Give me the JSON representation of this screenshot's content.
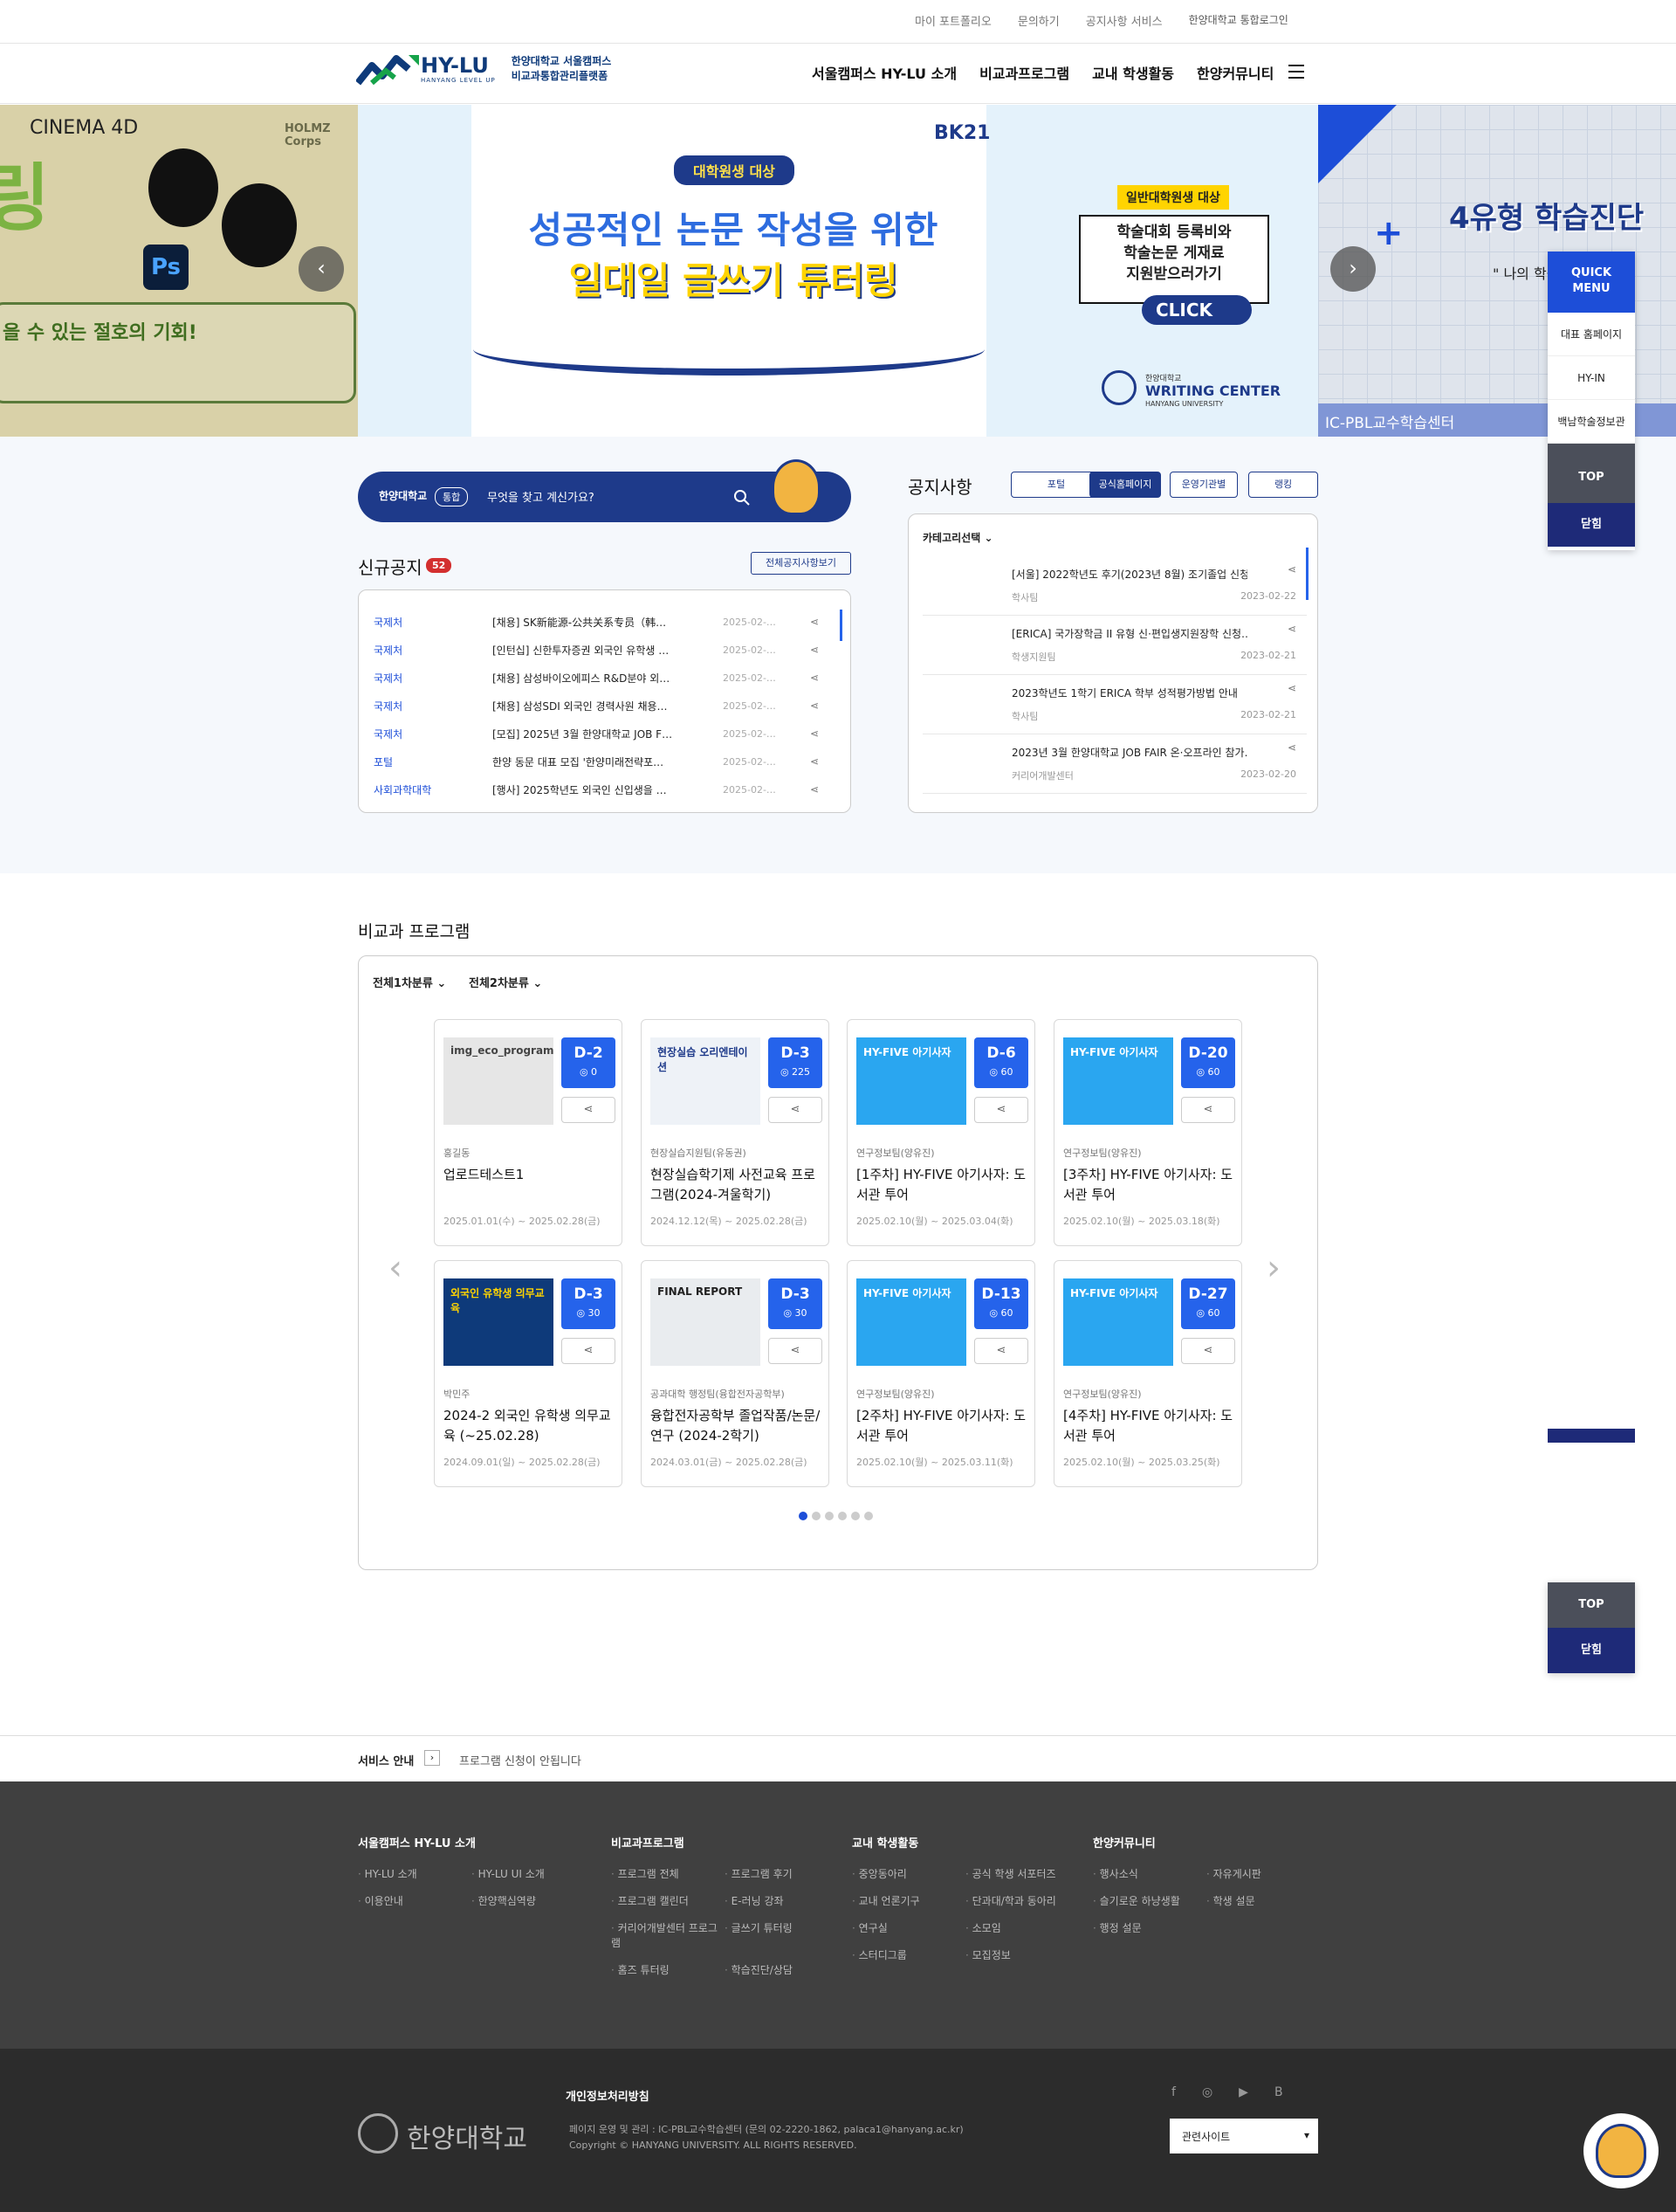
{
  "topbar": {
    "links": [
      "마이 포트폴리오",
      "문의하기",
      "공지사항 서비스",
      "한양대학교 통합로그인"
    ]
  },
  "header": {
    "logo_title": "HY-LU",
    "logo_sub": "HANYANG LEVEL UP",
    "logo_desc1": "한양대학교 서울캠퍼스",
    "logo_desc2": "비교과통합관리플랫폼",
    "nav": [
      "서울캠퍼스 HY-LU 소개",
      "비교과프로그램",
      "교내 학생활동",
      "한양커뮤니티"
    ]
  },
  "slider": {
    "left": {
      "brand": "CINEMA 4D",
      "corner": "HOLMZ Corps",
      "ps": "Ps",
      "big": "링",
      "line": "을 수 있는 절호의 기회!"
    },
    "mid": {
      "badge": "대학원생 대상",
      "title1": "성공적인 논문 작성을 위한",
      "title2": "일대일 글쓰기 튜터링",
      "bk": "BK21",
      "side_badge": "일반대학원생 대상",
      "side1": "학술대회 등록비와",
      "side2": "학술논문 게재료",
      "side3": "지원받으러가기",
      "click": "CLICK",
      "wc_top": "한양대학교",
      "wc": "WRITING CENTER",
      "wc_sub": "HANYANG UNIVERSITY"
    },
    "right": {
      "title": "4유형 학습진단",
      "quote": "\" 나의 학습자 문",
      "caption": "IC-PBL교수학습센터"
    },
    "dot_count": 7
  },
  "search": {
    "univ": "한양대학교",
    "tag": "통합",
    "placeholder": "무엇을 찾고 계신가요?"
  },
  "new_notice": {
    "title": "신규공지",
    "count": "52",
    "all_button": "전체공지사항보기",
    "rows": [
      {
        "cat": "국제처",
        "title": "[채용] SK新能源-公共关系专员（韩…",
        "date": "2025-02-…"
      },
      {
        "cat": "국제처",
        "title": "[인턴십] 신한투자증권 외국인 유학생 …",
        "date": "2025-02-…"
      },
      {
        "cat": "국제처",
        "title": "[채용] 삼성바이오에피스 R&D분야 외…",
        "date": "2025-02-…"
      },
      {
        "cat": "국제처",
        "title": "[채용] 삼성SDI 외국인 경력사원 채용…",
        "date": "2025-02-…"
      },
      {
        "cat": "국제처",
        "title": "[모집] 2025년 3월 한양대학교 JOB F…",
        "date": "2025-02-…"
      },
      {
        "cat": "포털",
        "title": "한양 동문 대표 모집 '한양미래전략포…",
        "date": "2025-02-…"
      },
      {
        "cat": "사회과학대학",
        "title": "[행사] 2025학년도 외국인 신입생을 …",
        "date": "2025-02-…"
      }
    ]
  },
  "announce": {
    "title": "공지사항",
    "tabs": [
      "포털",
      "공식홈페이지",
      "운영기관별",
      "랭킹"
    ],
    "category": "카테고리선택",
    "rows": [
      {
        "title": "[서울] 2022학년도 후기(2023년 8월) 조기졸업 신청 …",
        "dept": "학사팀",
        "date": "2023-02-22"
      },
      {
        "title": "[ERICA] 국가장학금 II 유형 신·편입생지원장학 신청…",
        "dept": "학생지원팀",
        "date": "2023-02-21"
      },
      {
        "title": "2023학년도 1학기 ERICA 학부 성적평가방법 안내",
        "dept": "학사팀",
        "date": "2023-02-21"
      },
      {
        "title": "2023년 3월 한양대학교 JOB FAIR 온·오프라인 참가…",
        "dept": "커리어개발센터",
        "date": "2023-02-20"
      }
    ]
  },
  "quick": {
    "title1": "QUICK",
    "title2": "MENU",
    "items": [
      "대표 홈페이지",
      "HY-IN",
      "백남학술정보관"
    ],
    "top": "TOP",
    "close": "닫힘"
  },
  "programs": {
    "title": "비교과 프로그램",
    "filter1": "전체1차분류",
    "filter2": "전체2차분류",
    "dot_count": 6,
    "cards": [
      {
        "d": "D-2",
        "views": "0",
        "org": "홍길동",
        "name": "업로드테스트1",
        "period": "2025.01.01(수) ~ 2025.02.28(금)",
        "thumb": "img_eco_program"
      },
      {
        "d": "D-3",
        "views": "225",
        "org": "현장실습지원팀(유동권)",
        "name": "현장실습학기제 사전교육 프로그램(2024-겨울학기)",
        "period": "2024.12.12(목) ~ 2025.02.28(금)",
        "thumb": "현장실습 오리엔테이션"
      },
      {
        "d": "D-6",
        "views": "60",
        "org": "연구정보팀(양유진)",
        "name": "[1주차] HY-FIVE 아기사자: 도서관 투어",
        "period": "2025.02.10(월) ~ 2025.03.04(화)",
        "thumb": "HY-FIVE 아기사자"
      },
      {
        "d": "D-20",
        "views": "60",
        "org": "연구정보팀(양유진)",
        "name": "[3주차] HY-FIVE 아기사자: 도서관 투어",
        "period": "2025.02.10(월) ~ 2025.03.18(화)",
        "thumb": "HY-FIVE 아기사자"
      },
      {
        "d": "D-3",
        "views": "30",
        "org": "박민주",
        "name": "2024-2 외국인 유학생 의무교육 (~25.02.28)",
        "period": "2024.09.01(일) ~ 2025.02.28(금)",
        "thumb": "외국인 유학생 의무교육"
      },
      {
        "d": "D-3",
        "views": "30",
        "org": "공과대학 행정팀(융합전자공학부)",
        "name": "융합전자공학부 졸업작품/논문/연구 (2024-2학기)",
        "period": "2024.03.01(금) ~ 2025.02.28(금)",
        "thumb": "FINAL REPORT"
      },
      {
        "d": "D-13",
        "views": "60",
        "org": "연구정보팀(양유진)",
        "name": "[2주차] HY-FIVE 아기사자: 도서관 투어",
        "period": "2025.02.10(월) ~ 2025.03.11(화)",
        "thumb": "HY-FIVE 아기사자"
      },
      {
        "d": "D-27",
        "views": "60",
        "org": "연구정보팀(양유진)",
        "name": "[4주차] HY-FIVE 아기사자: 도서관 투어",
        "period": "2025.02.10(월) ~ 2025.03.25(화)",
        "thumb": "HY-FIVE 아기사자"
      }
    ]
  },
  "float": {
    "top": "TOP",
    "close": "닫힘"
  },
  "service": {
    "label": "서비스 안내",
    "text": "프로그램 신청이 안됩니다"
  },
  "footer": {
    "cols": [
      {
        "title": "서울캠퍼스 HY-LU 소개",
        "items": [
          "HY-LU 소개",
          "HY-LU UI 소개",
          "이용안내",
          "한양핵심역량"
        ]
      },
      {
        "title": "비교과프로그램",
        "items": [
          "프로그램 전체",
          "프로그램 후기",
          "프로그램 캘린더",
          "E-러닝 강좌",
          "커리어개발센터 프로그램",
          "글쓰기 튜터링",
          "홈즈 튜터링",
          "학습진단/상담"
        ]
      },
      {
        "title": "교내 학생활동",
        "items": [
          "중앙동아리",
          "공식 학생 서포터즈",
          "교내 언론기구",
          "단과대/학과 동아리",
          "연구실",
          "소모임",
          "스터디그룹",
          "모집정보"
        ]
      },
      {
        "title": "한양커뮤니티",
        "items": [
          "행사소식",
          "자유게시판",
          "슬기로운 하냥생활",
          "학생 설문",
          "행정 설문"
        ]
      }
    ],
    "privacy": "개인정보처리방침",
    "manage": "페이지 운영 및 관리 : IC-PBL교수학습센터 (문의 02-2220-1862, palaca1@hanyang.ac.kr)",
    "copyright": "Copyright © HANYANG UNIVERSITY. ALL RIGHTS RESERVED.",
    "univ_name": "한양대학교",
    "related": "관련사이트",
    "social": [
      "f",
      "◎",
      "▶",
      "B"
    ]
  }
}
